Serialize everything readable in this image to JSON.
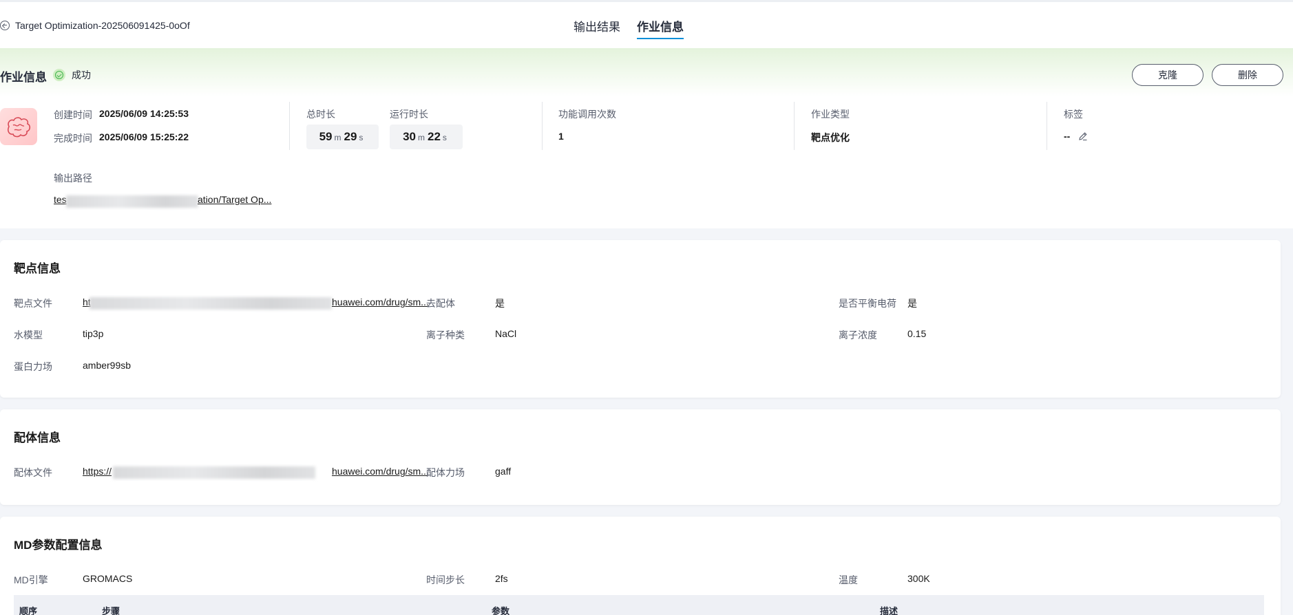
{
  "header": {
    "back_title": "Target Optimization-202506091425-0oOf",
    "tabs": [
      {
        "label": "输出结果",
        "active": false
      },
      {
        "label": "作业信息",
        "active": true
      }
    ]
  },
  "job": {
    "title": "作业信息",
    "status": "成功",
    "clone_label": "克隆",
    "delete_label": "删除",
    "created_label": "创建时间",
    "created_value": "2025/06/09 14:25:53",
    "finished_label": "完成时间",
    "finished_value": "2025/06/09 15:25:22",
    "total_duration_label": "总时长",
    "total_duration": {
      "m": "59",
      "m_unit": "m",
      "s": "29",
      "s_unit": "s"
    },
    "run_duration_label": "运行时长",
    "run_duration": {
      "m": "30",
      "m_unit": "m",
      "s": "22",
      "s_unit": "s"
    },
    "calls_label": "功能调用次数",
    "calls_value": "1",
    "type_label": "作业类型",
    "type_value": "靶点优化",
    "tag_label": "标签",
    "tag_value": "--",
    "output_path_label": "输出路径",
    "output_path_start": "tes",
    "output_path_end": "ation/Target Op..."
  },
  "target": {
    "title": "靶点信息",
    "file_label": "靶点文件",
    "file_start": "ht",
    "file_end": "huawei.com/drug/sm...",
    "remove_ligand_label": "去配体",
    "remove_ligand_value": "是",
    "balance_label": "是否平衡电荷",
    "balance_value": "是",
    "water_label": "水模型",
    "water_value": "tip3p",
    "ion_type_label": "离子种类",
    "ion_type_value": "NaCl",
    "ion_conc_label": "离子浓度",
    "ion_conc_value": "0.15",
    "forcefield_label": "蛋白力场",
    "forcefield_value": "amber99sb"
  },
  "ligand": {
    "title": "配体信息",
    "file_label": "配体文件",
    "file_start": "https://",
    "file_end": "huawei.com/drug/sm...",
    "forcefield_label": "配体力场",
    "forcefield_value": "gaff"
  },
  "md": {
    "title": "MD参数配置信息",
    "engine_label": "MD引擎",
    "engine_value": "GROMACS",
    "timestep_label": "时间步长",
    "timestep_value": "2fs",
    "temp_label": "温度",
    "temp_value": "300K",
    "table_headers": [
      "顺序",
      "步骤",
      "参数",
      "描述"
    ]
  }
}
